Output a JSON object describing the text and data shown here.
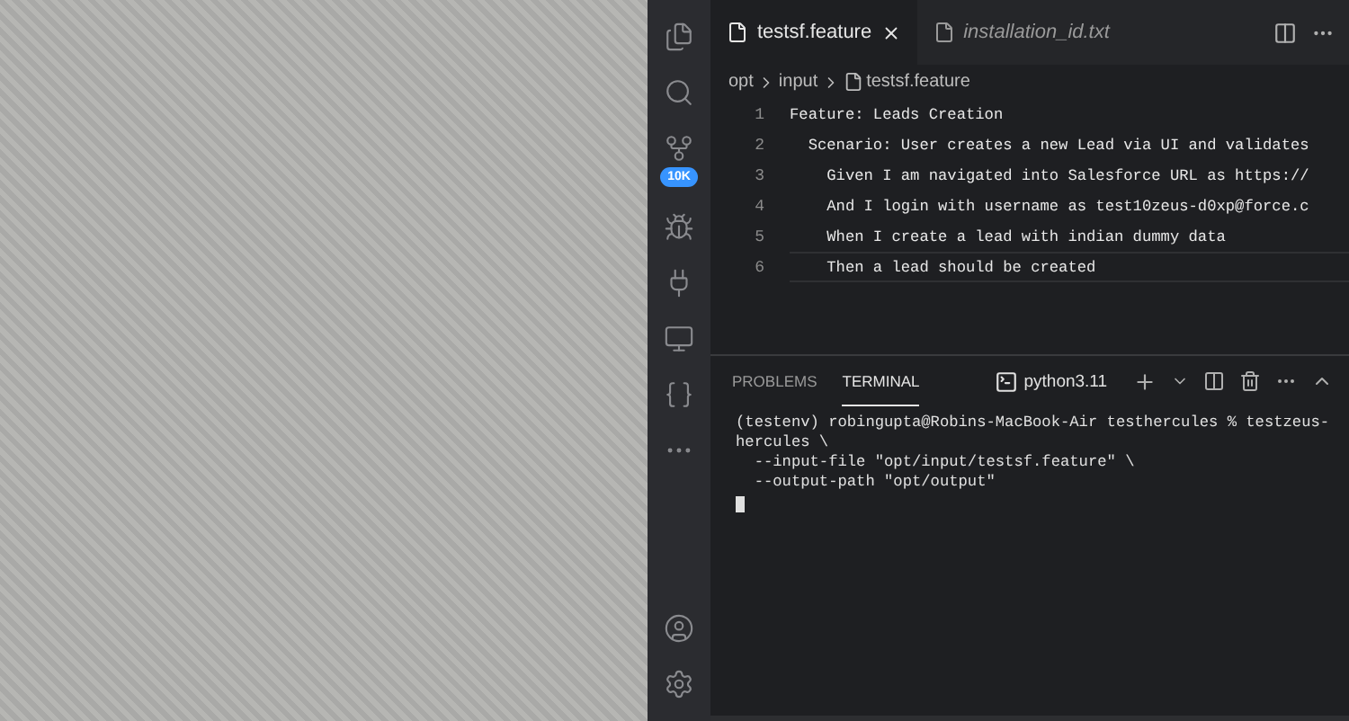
{
  "activity_bar": {
    "source_control_badge": "10K"
  },
  "editor": {
    "tabs": [
      {
        "label": "testsf.feature",
        "selected": true,
        "preview": false
      },
      {
        "label": "installation_id.txt",
        "selected": false,
        "preview": true
      }
    ],
    "breadcrumbs": [
      "opt",
      "input",
      "testsf.feature"
    ],
    "lines": [
      {
        "number": "1",
        "text": "Feature: Leads Creation",
        "current": false
      },
      {
        "number": "2",
        "text": "  Scenario: User creates a new Lead via UI and validates",
        "current": false
      },
      {
        "number": "3",
        "text": "    Given I am navigated into Salesforce URL as https://",
        "current": false
      },
      {
        "number": "4",
        "text": "    And I login with username as test10zeus-d0xp@force.c",
        "current": false
      },
      {
        "number": "5",
        "text": "    When I create a lead with indian dummy data",
        "current": false
      },
      {
        "number": "6",
        "text": "    Then a lead should be created",
        "current": true
      }
    ]
  },
  "panel": {
    "tabs": [
      {
        "label": "PROBLEMS",
        "selected": false
      },
      {
        "label": "TERMINAL",
        "selected": true
      }
    ],
    "terminal_name": "python3.11",
    "terminal_lines": [
      "(testenv) robingupta@Robins-MacBook-Air testhercules % testzeus-",
      "hercules \\",
      "  --input-file \"opt/input/testsf.feature\" \\",
      "  --output-path \"opt/output\""
    ]
  }
}
